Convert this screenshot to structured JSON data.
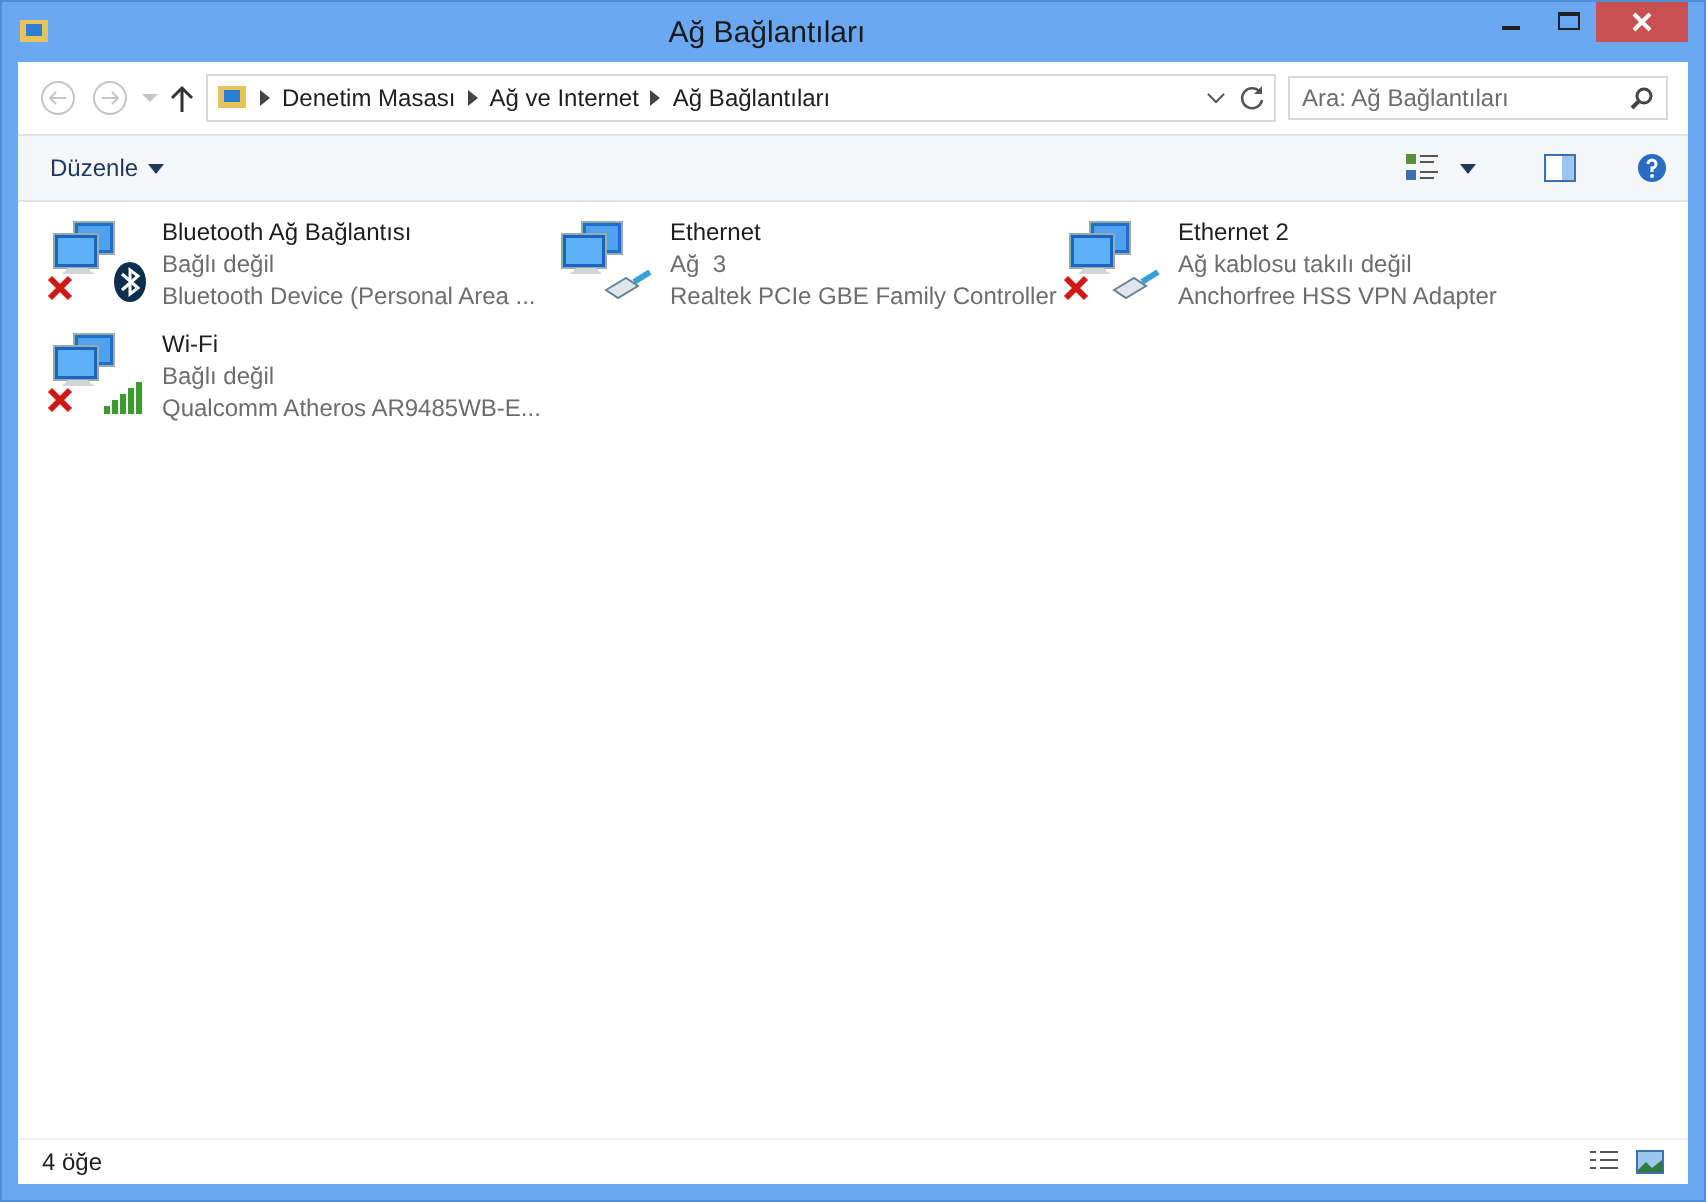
{
  "window": {
    "title": "Ağ Bağlantıları"
  },
  "address_bar": {
    "breadcrumbs": [
      "Denetim Masası",
      "Ağ ve Internet",
      "Ağ Bağlantıları"
    ]
  },
  "search": {
    "placeholder": "Ara: Ağ Bağlantıları"
  },
  "toolbar": {
    "organize": "Düzenle"
  },
  "connections": [
    {
      "name": "Bluetooth Ağ Bağlantısı",
      "status": "Bağlı değil",
      "device": "Bluetooth Device (Personal Area ...",
      "kind": "bluetooth",
      "disconnected": true
    },
    {
      "name": "Ethernet",
      "status": "Ağ  3",
      "device": "Realtek PCIe GBE Family Controller",
      "kind": "ethernet",
      "disconnected": false
    },
    {
      "name": "Ethernet 2",
      "status": "Ağ kablosu takılı değil",
      "device": "Anchorfree HSS VPN Adapter",
      "kind": "ethernet",
      "disconnected": true
    },
    {
      "name": "Wi-Fi",
      "status": "Bağlı değil",
      "device": "Qualcomm Atheros AR9485WB-E...",
      "kind": "wifi",
      "disconnected": true
    }
  ],
  "status_bar": {
    "count": "4 öğe"
  }
}
